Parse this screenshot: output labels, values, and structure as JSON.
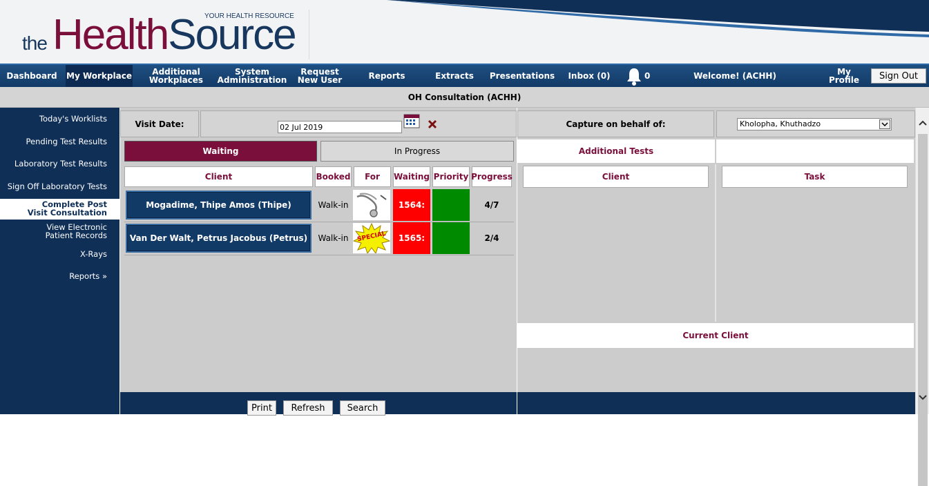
{
  "header": {
    "logo_the": "the",
    "logo_health": "Health",
    "logo_source": "Source",
    "tagline": "YOUR HEALTH RESOURCE"
  },
  "nav": {
    "dashboard": "Dashboard",
    "my_workplace": "My Workplace",
    "additional_workplaces": "Additional Workplaces",
    "system_administration": "System Administration",
    "request_new_user": "Request New User",
    "reports": "Reports",
    "extracts": "Extracts",
    "presentations": "Presentations",
    "inbox": "Inbox (0)",
    "notifications_count": "0",
    "welcome": "Welcome! (ACHH)",
    "my_profile": "My Profile",
    "sign_out": "Sign Out"
  },
  "page_title": "OH Consultation (ACHH)",
  "sidebar": {
    "items": [
      "Today's Worklists",
      "Pending Test Results",
      "Laboratory Test Results",
      "Sign Off Laboratory Tests",
      "Complete Post Visit Consultation",
      "View Electronic Patient Records",
      "X-Rays",
      "Reports »"
    ],
    "active_index": 4
  },
  "visit": {
    "date_label": "Visit Date:",
    "date_value": "02 Jul 2019",
    "capture_label": "Capture on behalf of:",
    "capture_value": "Kholopha, Khuthadzo"
  },
  "tabs": {
    "waiting": "Waiting",
    "in_progress": "In Progress",
    "additional_tests": "Additional Tests"
  },
  "table": {
    "columns": [
      "Client",
      "Booked",
      "For",
      "Waiting",
      "Priority",
      "Progress"
    ],
    "rows": [
      {
        "client": "Mogadime, Thipe Amos (Thipe)",
        "booked": "Walk-in",
        "for_icon": "stethoscope-icon",
        "waiting": "1564:",
        "priority_color": "#008a00",
        "progress": "4/7"
      },
      {
        "client": "Van Der Walt, Petrus Jacobus (Petrus)",
        "booked": "Walk-in",
        "for_icon": "special-starburst-icon",
        "for_text": "SPECIAL",
        "waiting": "1565:",
        "priority_color": "#008a00",
        "progress": "2/4"
      }
    ]
  },
  "right_panel": {
    "client_header": "Client",
    "task_header": "Task",
    "current_client": "Current Client"
  },
  "buttons": {
    "print": "Print",
    "refresh": "Refresh",
    "search": "Search"
  },
  "colors": {
    "brand_navy": "#0f2f57",
    "brand_maroon": "#7a0f3b",
    "waiting_red": "#ff0000",
    "priority_green": "#008a00"
  }
}
